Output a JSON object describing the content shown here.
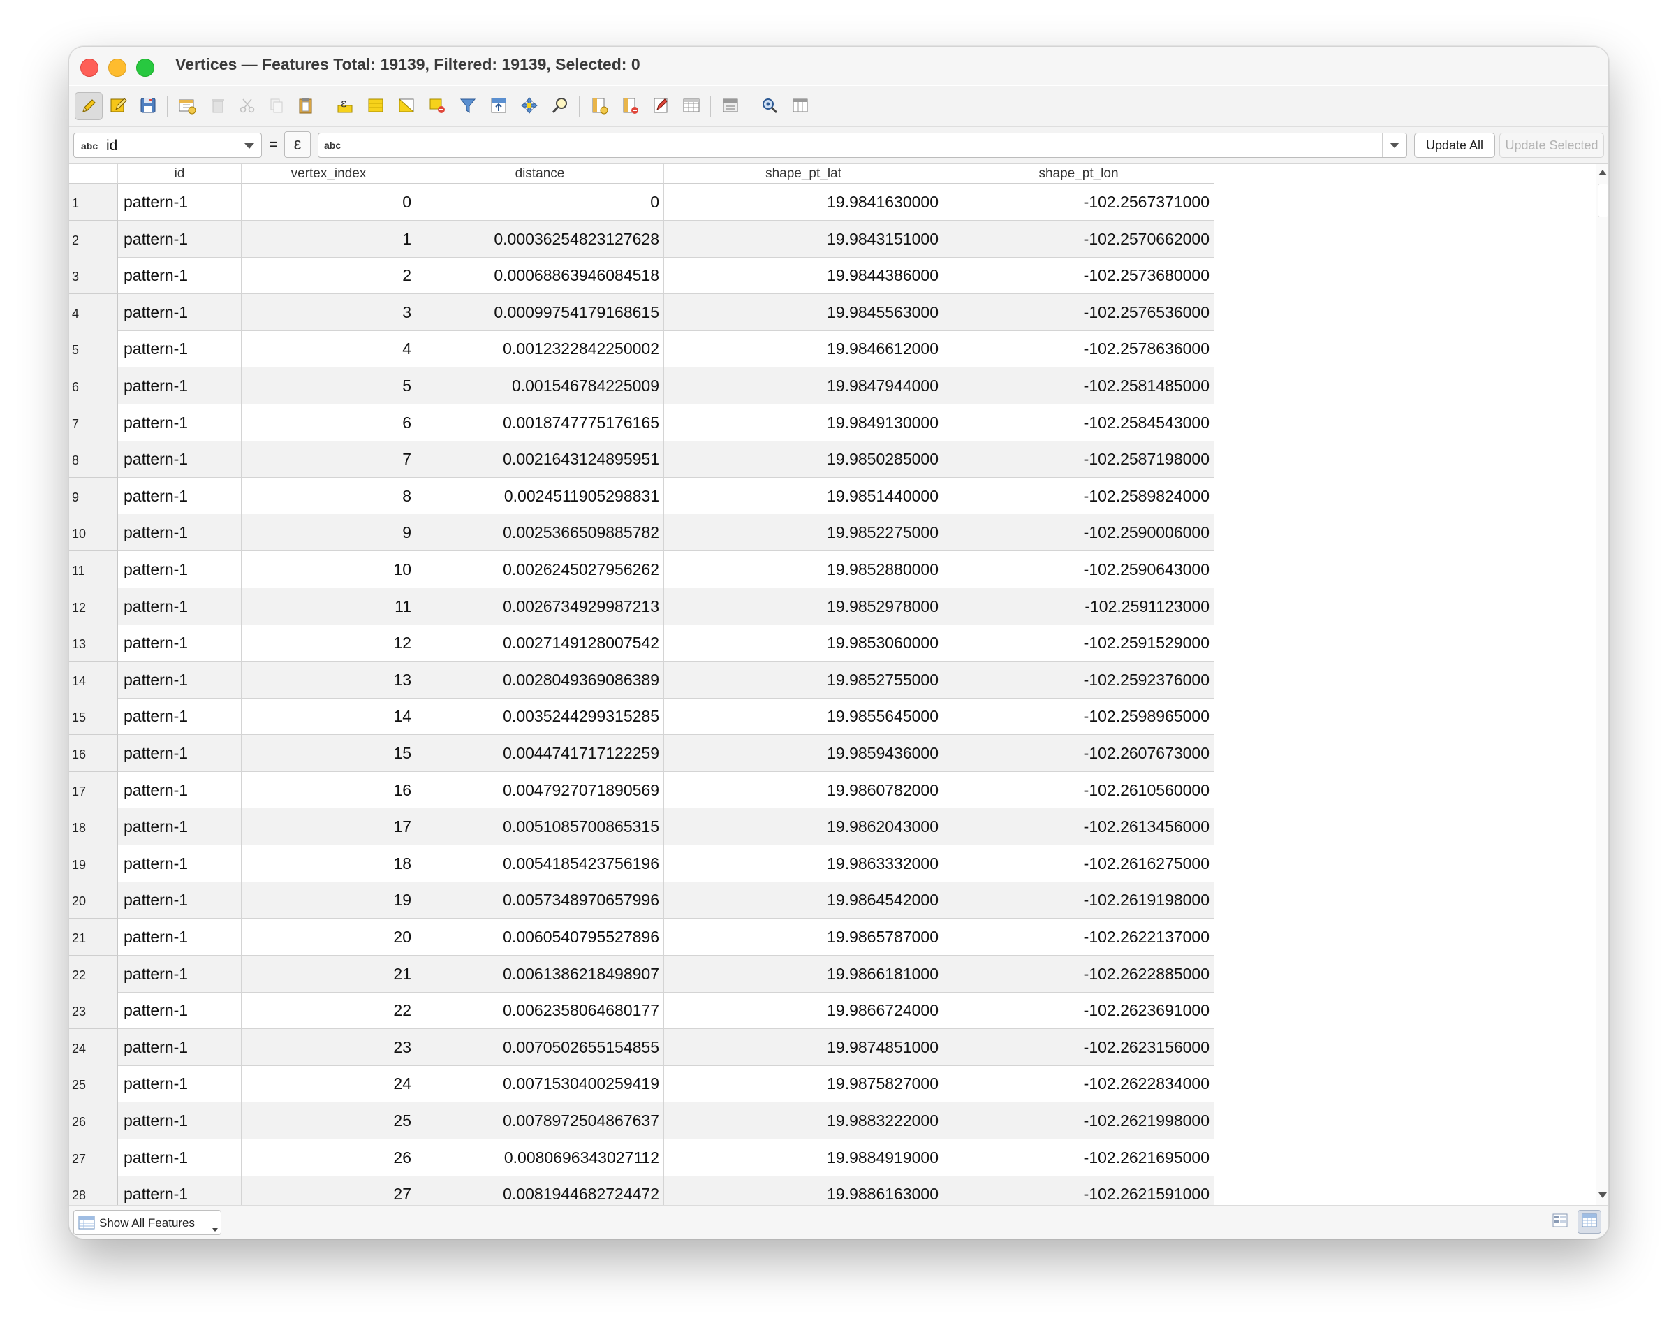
{
  "window": {
    "title": "Vertices — Features Total: 19139, Filtered: 19139, Selected: 0"
  },
  "toolbar": {
    "buttons": [
      {
        "name": "toggle-editing-icon",
        "active": true
      },
      {
        "name": "multi-edit-icon"
      },
      {
        "name": "save-edits-icon"
      },
      {
        "name": "add-feature-icon"
      },
      {
        "name": "delete-selected-icon"
      },
      {
        "name": "cut-icon"
      },
      {
        "name": "copy-icon"
      },
      {
        "name": "paste-icon"
      },
      {
        "name": "select-by-expression-icon"
      },
      {
        "name": "select-all-icon"
      },
      {
        "name": "invert-selection-icon"
      },
      {
        "name": "deselect-all-icon"
      },
      {
        "name": "filter-select-icon"
      },
      {
        "name": "move-selection-top-icon"
      },
      {
        "name": "pan-to-selected-icon"
      },
      {
        "name": "zoom-to-selected-icon"
      },
      {
        "name": "new-field-icon"
      },
      {
        "name": "delete-field-icon"
      },
      {
        "name": "field-calculator-icon"
      },
      {
        "name": "conditional-formatting-icon"
      },
      {
        "name": "dock-icon"
      },
      {
        "name": "actions-icon"
      },
      {
        "name": "organize-columns-icon"
      }
    ]
  },
  "expression_bar": {
    "field_type": "abc",
    "field": "id",
    "equals": "=",
    "epsilon": "ε",
    "expr_type": "abc",
    "expr_value": "",
    "update_all": "Update All",
    "update_selected": "Update Selected"
  },
  "table": {
    "columns": [
      "id",
      "vertex_index",
      "distance",
      "shape_pt_lat",
      "shape_pt_lon"
    ],
    "rows": [
      {
        "n": "1",
        "id": "pattern-1",
        "vertex_index": "0",
        "distance": "0",
        "lat": "19.9841630000",
        "lon": "-102.2567371000"
      },
      {
        "n": "2",
        "id": "pattern-1",
        "vertex_index": "1",
        "distance": "0.00036254823127628",
        "lat": "19.9843151000",
        "lon": "-102.2570662000"
      },
      {
        "n": "3",
        "id": "pattern-1",
        "vertex_index": "2",
        "distance": "0.00068863946084518",
        "lat": "19.9844386000",
        "lon": "-102.2573680000"
      },
      {
        "n": "4",
        "id": "pattern-1",
        "vertex_index": "3",
        "distance": "0.00099754179168615",
        "lat": "19.9845563000",
        "lon": "-102.2576536000"
      },
      {
        "n": "5",
        "id": "pattern-1",
        "vertex_index": "4",
        "distance": "0.0012322842250002",
        "lat": "19.9846612000",
        "lon": "-102.2578636000"
      },
      {
        "n": "6",
        "id": "pattern-1",
        "vertex_index": "5",
        "distance": "0.001546784225009",
        "lat": "19.9847944000",
        "lon": "-102.2581485000"
      },
      {
        "n": "7",
        "id": "pattern-1",
        "vertex_index": "6",
        "distance": "0.0018747775176165",
        "lat": "19.9849130000",
        "lon": "-102.2584543000"
      },
      {
        "n": "8",
        "id": "pattern-1",
        "vertex_index": "7",
        "distance": "0.0021643124895951",
        "lat": "19.9850285000",
        "lon": "-102.2587198000"
      },
      {
        "n": "9",
        "id": "pattern-1",
        "vertex_index": "8",
        "distance": "0.0024511905298831",
        "lat": "19.9851440000",
        "lon": "-102.2589824000"
      },
      {
        "n": "10",
        "id": "pattern-1",
        "vertex_index": "9",
        "distance": "0.0025366509885782",
        "lat": "19.9852275000",
        "lon": "-102.2590006000"
      },
      {
        "n": "11",
        "id": "pattern-1",
        "vertex_index": "10",
        "distance": "0.0026245027956262",
        "lat": "19.9852880000",
        "lon": "-102.2590643000"
      },
      {
        "n": "12",
        "id": "pattern-1",
        "vertex_index": "11",
        "distance": "0.0026734929987213",
        "lat": "19.9852978000",
        "lon": "-102.2591123000"
      },
      {
        "n": "13",
        "id": "pattern-1",
        "vertex_index": "12",
        "distance": "0.0027149128007542",
        "lat": "19.9853060000",
        "lon": "-102.2591529000"
      },
      {
        "n": "14",
        "id": "pattern-1",
        "vertex_index": "13",
        "distance": "0.0028049369086389",
        "lat": "19.9852755000",
        "lon": "-102.2592376000"
      },
      {
        "n": "15",
        "id": "pattern-1",
        "vertex_index": "14",
        "distance": "0.0035244299315285",
        "lat": "19.9855645000",
        "lon": "-102.2598965000"
      },
      {
        "n": "16",
        "id": "pattern-1",
        "vertex_index": "15",
        "distance": "0.0044741717122259",
        "lat": "19.9859436000",
        "lon": "-102.2607673000"
      },
      {
        "n": "17",
        "id": "pattern-1",
        "vertex_index": "16",
        "distance": "0.0047927071890569",
        "lat": "19.9860782000",
        "lon": "-102.2610560000"
      },
      {
        "n": "18",
        "id": "pattern-1",
        "vertex_index": "17",
        "distance": "0.0051085700865315",
        "lat": "19.9862043000",
        "lon": "-102.2613456000"
      },
      {
        "n": "19",
        "id": "pattern-1",
        "vertex_index": "18",
        "distance": "0.0054185423756196",
        "lat": "19.9863332000",
        "lon": "-102.2616275000"
      },
      {
        "n": "20",
        "id": "pattern-1",
        "vertex_index": "19",
        "distance": "0.0057348970657996",
        "lat": "19.9864542000",
        "lon": "-102.2619198000"
      },
      {
        "n": "21",
        "id": "pattern-1",
        "vertex_index": "20",
        "distance": "0.0060540795527896",
        "lat": "19.9865787000",
        "lon": "-102.2622137000"
      },
      {
        "n": "22",
        "id": "pattern-1",
        "vertex_index": "21",
        "distance": "0.0061386218498907",
        "lat": "19.9866181000",
        "lon": "-102.2622885000"
      },
      {
        "n": "23",
        "id": "pattern-1",
        "vertex_index": "22",
        "distance": "0.0062358064680177",
        "lat": "19.9866724000",
        "lon": "-102.2623691000"
      },
      {
        "n": "24",
        "id": "pattern-1",
        "vertex_index": "23",
        "distance": "0.0070502655154855",
        "lat": "19.9874851000",
        "lon": "-102.2623156000"
      },
      {
        "n": "25",
        "id": "pattern-1",
        "vertex_index": "24",
        "distance": "0.0071530400259419",
        "lat": "19.9875827000",
        "lon": "-102.2622834000"
      },
      {
        "n": "26",
        "id": "pattern-1",
        "vertex_index": "25",
        "distance": "0.0078972504867637",
        "lat": "19.9883222000",
        "lon": "-102.2621998000"
      },
      {
        "n": "27",
        "id": "pattern-1",
        "vertex_index": "26",
        "distance": "0.0080696343027112",
        "lat": "19.9884919000",
        "lon": "-102.2621695000"
      },
      {
        "n": "28",
        "id": "pattern-1",
        "vertex_index": "27",
        "distance": "0.0081944682724472",
        "lat": "19.9886163000",
        "lon": "-102.2621591000"
      }
    ]
  },
  "bottom_bar": {
    "filter_label": "Show All Features",
    "views": [
      {
        "name": "form-view-icon",
        "selected": false
      },
      {
        "name": "table-view-icon",
        "selected": true
      }
    ]
  },
  "colors": {
    "close": "#fe5f57",
    "minimize": "#febc2e",
    "zoom": "#28c840",
    "pencil": "#f0c419",
    "selection_yellow": "#f6d21b",
    "disabled_text": "#b4b4b4"
  }
}
